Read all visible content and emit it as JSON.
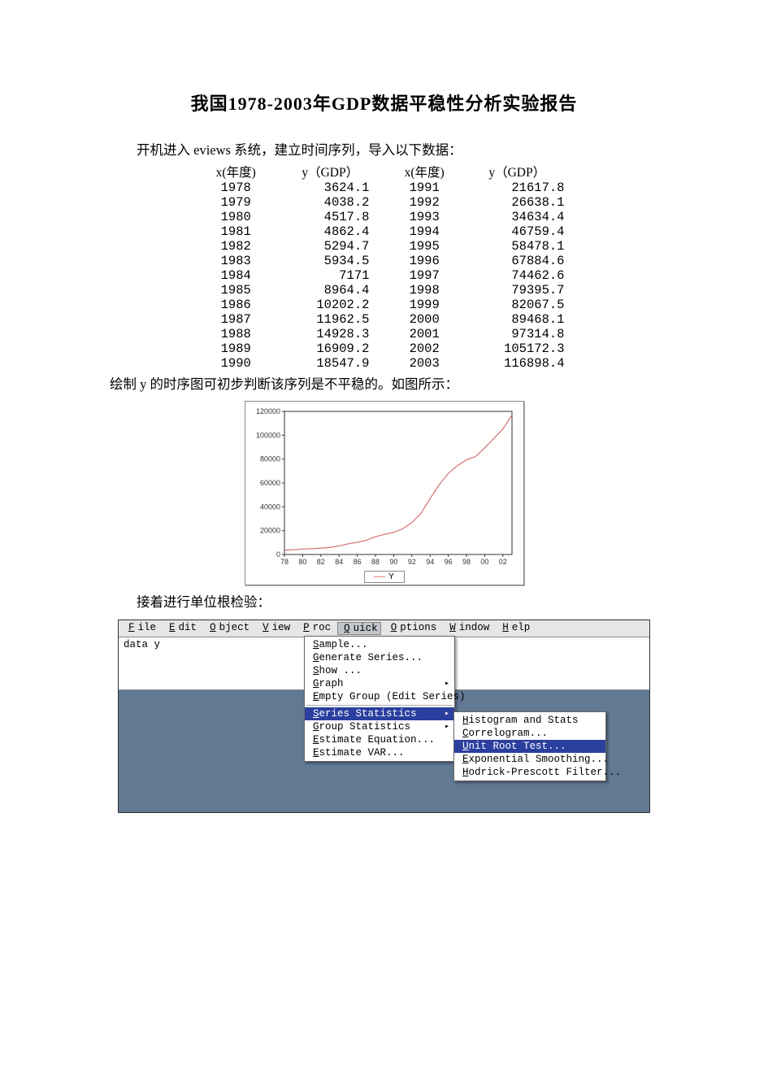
{
  "doc": {
    "title": "我国1978-2003年GDP数据平稳性分析实验报告",
    "intro": "开机进入 eviews 系统，建立时间序列，导入以下数据：",
    "chart_intro": "绘制 y 的时序图可初步判断该序列是不平稳的。如图所示：",
    "unit_root_intro": "接着进行单位根检验："
  },
  "table": {
    "headers": {
      "x": "x(年度)",
      "y": "y（GDP）",
      "x2": "x(年度)",
      "y2": "y（GDP）"
    },
    "rows": [
      {
        "x": "1978",
        "y": "3624.1",
        "x2": "1991",
        "y2": "21617.8"
      },
      {
        "x": "1979",
        "y": "4038.2",
        "x2": "1992",
        "y2": "26638.1"
      },
      {
        "x": "1980",
        "y": "4517.8",
        "x2": "1993",
        "y2": "34634.4"
      },
      {
        "x": "1981",
        "y": "4862.4",
        "x2": "1994",
        "y2": "46759.4"
      },
      {
        "x": "1982",
        "y": "5294.7",
        "x2": "1995",
        "y2": "58478.1"
      },
      {
        "x": "1983",
        "y": "5934.5",
        "x2": "1996",
        "y2": "67884.6"
      },
      {
        "x": "1984",
        "y": "7171",
        "x2": "1997",
        "y2": "74462.6"
      },
      {
        "x": "1985",
        "y": "8964.4",
        "x2": "1998",
        "y2": "79395.7"
      },
      {
        "x": "1986",
        "y": "10202.2",
        "x2": "1999",
        "y2": "82067.5"
      },
      {
        "x": "1987",
        "y": "11962.5",
        "x2": "2000",
        "y2": "89468.1"
      },
      {
        "x": "1988",
        "y": "14928.3",
        "x2": "2001",
        "y2": "97314.8"
      },
      {
        "x": "1989",
        "y": "16909.2",
        "x2": "2002",
        "y2": "105172.3"
      },
      {
        "x": "1990",
        "y": "18547.9",
        "x2": "2003",
        "y2": "116898.4"
      }
    ]
  },
  "chart_data": {
    "type": "line",
    "series": [
      {
        "name": "Y",
        "x": [
          1978,
          1979,
          1980,
          1981,
          1982,
          1983,
          1984,
          1985,
          1986,
          1987,
          1988,
          1989,
          1990,
          1991,
          1992,
          1993,
          1994,
          1995,
          1996,
          1997,
          1998,
          1999,
          2000,
          2001,
          2002,
          2003
        ],
        "y": [
          3624.1,
          4038.2,
          4517.8,
          4862.4,
          5294.7,
          5934.5,
          7171,
          8964.4,
          10202.2,
          11962.5,
          14928.3,
          16909.2,
          18547.9,
          21617.8,
          26638.1,
          34634.4,
          46759.4,
          58478.1,
          67884.6,
          74462.6,
          79395.7,
          82067.5,
          89468.1,
          97314.8,
          105172.3,
          116898.4
        ]
      }
    ],
    "xlim": [
      1978,
      2003
    ],
    "ylim": [
      0,
      120000
    ],
    "x_ticks": [
      "78",
      "80",
      "82",
      "84",
      "86",
      "88",
      "90",
      "92",
      "94",
      "96",
      "98",
      "00",
      "02"
    ],
    "y_ticks": [
      0,
      20000,
      40000,
      60000,
      80000,
      100000,
      120000
    ],
    "line_color": "#d87a7a",
    "legend": "Y"
  },
  "eviews": {
    "cmd": "data y",
    "menubar": [
      "File",
      "Edit",
      "Object",
      "View",
      "Proc",
      "Quick",
      "Options",
      "Window",
      "Help"
    ],
    "active_menu": "Quick",
    "dropdown": [
      {
        "label": "Sample..."
      },
      {
        "label": "Generate Series..."
      },
      {
        "label": "Show ..."
      },
      {
        "label": "Graph",
        "arrow": true
      },
      {
        "label": "Empty Group (Edit Series)"
      },
      {
        "sep": true
      },
      {
        "label": "Series Statistics",
        "arrow": true,
        "hl": true
      },
      {
        "label": "Group Statistics",
        "arrow": true
      },
      {
        "label": "Estimate Equation..."
      },
      {
        "label": "Estimate VAR..."
      }
    ],
    "submenu": [
      {
        "label": "Histogram and Stats"
      },
      {
        "label": "Correlogram..."
      },
      {
        "label": "Unit Root Test...",
        "hl": true
      },
      {
        "label": "Exponential Smoothing..."
      },
      {
        "label": "Hodrick-Prescott Filter..."
      }
    ]
  }
}
